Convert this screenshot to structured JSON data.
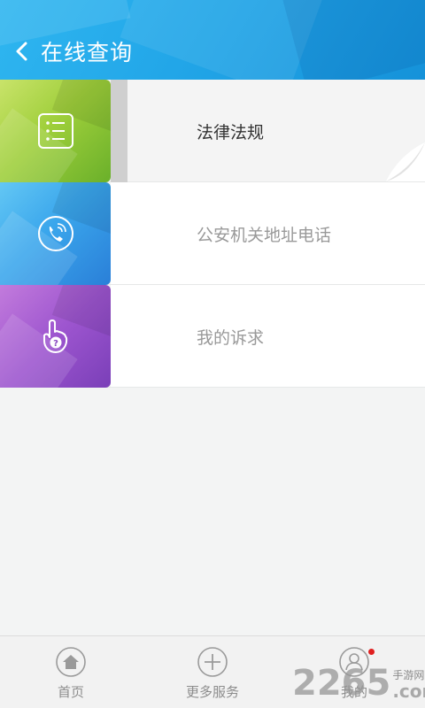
{
  "header": {
    "title": "在线查询",
    "back_icon": "chevron-left-icon",
    "color": "#22a6e8"
  },
  "list": [
    {
      "label": "法律法规",
      "icon": "list-icon",
      "color": "#9fcf3b",
      "active": true
    },
    {
      "label": "公安机关地址电话",
      "icon": "phone-icon",
      "color": "#3aa6ec",
      "active": false
    },
    {
      "label": "我的诉求",
      "icon": "hand-question-icon",
      "color": "#9d55cf",
      "active": false
    }
  ],
  "bottom_nav": [
    {
      "label": "首页",
      "icon": "home-icon"
    },
    {
      "label": "更多服务",
      "icon": "plus-circle-icon"
    },
    {
      "label": "我的",
      "icon": "user-icon",
      "badge": true
    }
  ],
  "watermark": {
    "number": "2265",
    "site": "手游网",
    "domain": ".com"
  }
}
